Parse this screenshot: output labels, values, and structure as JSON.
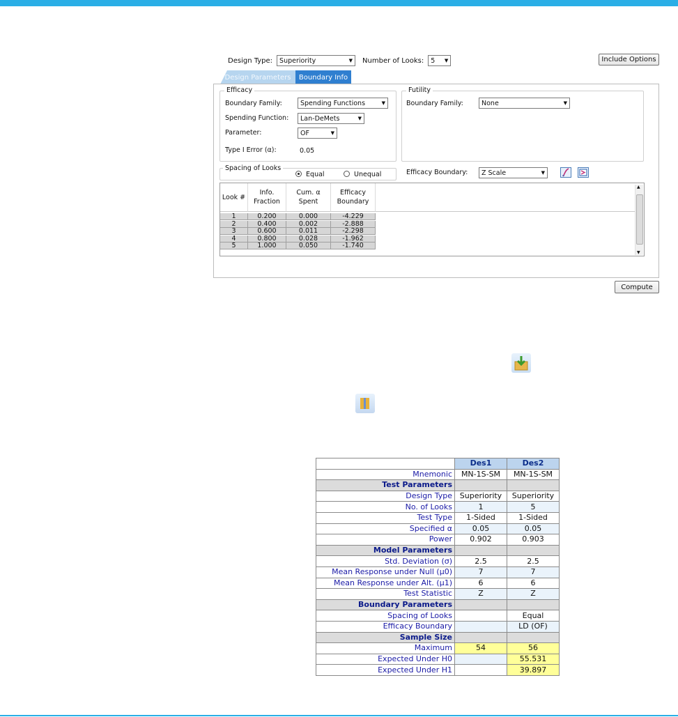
{
  "dialog": {
    "design_type_label": "Design Type:",
    "design_type_value": "Superiority",
    "num_looks_label": "Number of Looks:",
    "num_looks_value": "5",
    "include_options": "Include Options",
    "tabs": [
      "Design Parameters",
      "Boundary Info"
    ],
    "efficacy": {
      "title": "Efficacy",
      "boundary_family_label": "Boundary Family:",
      "boundary_family_value": "Spending Functions",
      "spending_function_label": "Spending Function:",
      "spending_function_value": "Lan-DeMets",
      "parameter_label": "Parameter:",
      "parameter_value": "OF",
      "type1_label": "Type I Error (α):",
      "type1_value": "0.05"
    },
    "futility": {
      "title": "Futility",
      "boundary_family_label": "Boundary Family:",
      "boundary_family_value": "None"
    },
    "spacing": {
      "title": "Spacing of Looks",
      "equal": "Equal",
      "unequal": "Unequal"
    },
    "efficacy_boundary_label": "Efficacy Boundary:",
    "efficacy_boundary_value": "Z Scale",
    "grid": {
      "headers": [
        "Look #",
        "Info.\nFraction",
        "Cum. α\nSpent",
        "Efficacy\nBoundary"
      ],
      "rows": [
        [
          "1",
          "0.200",
          "0.000",
          "-4.229"
        ],
        [
          "2",
          "0.400",
          "0.002",
          "-2.888"
        ],
        [
          "3",
          "0.600",
          "0.011",
          "-2.298"
        ],
        [
          "4",
          "0.800",
          "0.028",
          "-1.962"
        ],
        [
          "5",
          "1.000",
          "0.050",
          "-1.740"
        ]
      ]
    },
    "compute": "Compute"
  },
  "icons": {
    "save_to_library": "save-icon",
    "compare": "compare-icon",
    "plot": "plot-icon",
    "table": "table-icon"
  },
  "compare_table": {
    "columns": [
      "Des1",
      "Des2"
    ],
    "rows": [
      {
        "kind": "row",
        "label": "Mnemonic",
        "v1": "MN-1S-SM",
        "v2": "MN-1S-SM"
      },
      {
        "kind": "section",
        "label": "Test Parameters"
      },
      {
        "kind": "row",
        "label": "Design Type",
        "v1": "Superiority",
        "v2": "Superiority"
      },
      {
        "kind": "row",
        "label": "No. of Looks",
        "v1": "1",
        "v2": "5"
      },
      {
        "kind": "row",
        "label": "Test Type",
        "v1": "1-Sided",
        "v2": "1-Sided"
      },
      {
        "kind": "row",
        "label": "Specified α",
        "v1": "0.05",
        "v2": "0.05"
      },
      {
        "kind": "row",
        "label": "Power",
        "v1": "0.902",
        "v2": "0.903"
      },
      {
        "kind": "section",
        "label": "Model Parameters"
      },
      {
        "kind": "row",
        "label": "Std. Deviation (σ)",
        "v1": "2.5",
        "v2": "2.5"
      },
      {
        "kind": "row",
        "label": "Mean Response under Null (μ0)",
        "v1": "7",
        "v2": "7"
      },
      {
        "kind": "row",
        "label": "Mean Response under Alt. (μ1)",
        "v1": "6",
        "v2": "6"
      },
      {
        "kind": "row",
        "label": "Test Statistic",
        "v1": "Z",
        "v2": "Z"
      },
      {
        "kind": "section",
        "label": "Boundary Parameters"
      },
      {
        "kind": "row",
        "label": "Spacing of Looks",
        "v1": "",
        "v2": "Equal"
      },
      {
        "kind": "row",
        "label": "Efficacy Boundary",
        "v1": "",
        "v2": "LD (OF)"
      },
      {
        "kind": "section",
        "label": "Sample Size"
      },
      {
        "kind": "row",
        "label": "Maximum",
        "v1": "54",
        "v2": "56",
        "hl1": true,
        "hl2": true
      },
      {
        "kind": "row",
        "label": "Expected Under H0",
        "v1": "",
        "v2": "55.531",
        "hl2": true
      },
      {
        "kind": "row",
        "label": "Expected Under H1",
        "v1": "",
        "v2": "39.897",
        "hl2": true
      }
    ]
  }
}
